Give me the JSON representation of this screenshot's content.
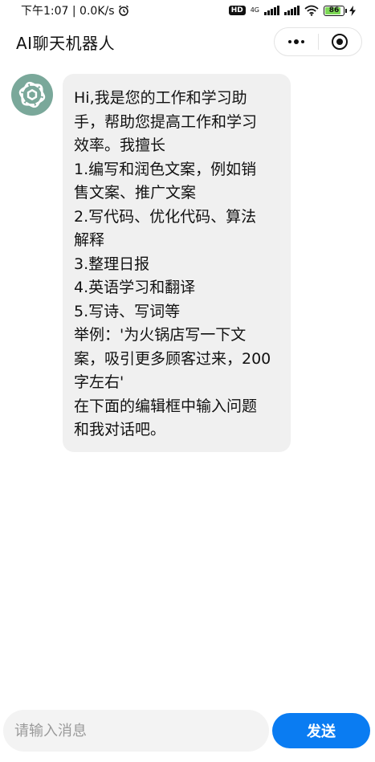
{
  "status_bar": {
    "time_speed": "下午1:07 | 0.0K/s",
    "hd_label": "HD",
    "network_label": "4G",
    "battery_level": "86",
    "battery_fraction": 0.86
  },
  "nav": {
    "title": "AI聊天机器人",
    "more_icon": "more-dots-icon",
    "close_icon": "target-circle-icon"
  },
  "chat": {
    "messages": [
      {
        "sender": "assistant",
        "avatar_icon": "openai-logo-icon",
        "text": "Hi,我是您的工作和学习助\n手，帮助您提高工作和学习\n效率。我擅长\n1.编写和润色文案，例如销\n售文案、推广文案\n2.写代码、优化代码、算法\n解释\n3.整理日报\n4.英语学习和翻译\n5.写诗、写词等\n举例：'为火锅店写一下文\n案，吸引更多顾客过来，200\n字左右'\n在下面的编辑框中输入问题\n和我对话吧。"
      }
    ]
  },
  "input_bar": {
    "placeholder": "请输入消息",
    "value": "",
    "send_label": "发送"
  },
  "colors": {
    "accent": "#0a7cf2",
    "avatar_bg": "#7aa89a",
    "bubble_bg": "#f0f0f0",
    "battery_fill": "#7ed957"
  }
}
